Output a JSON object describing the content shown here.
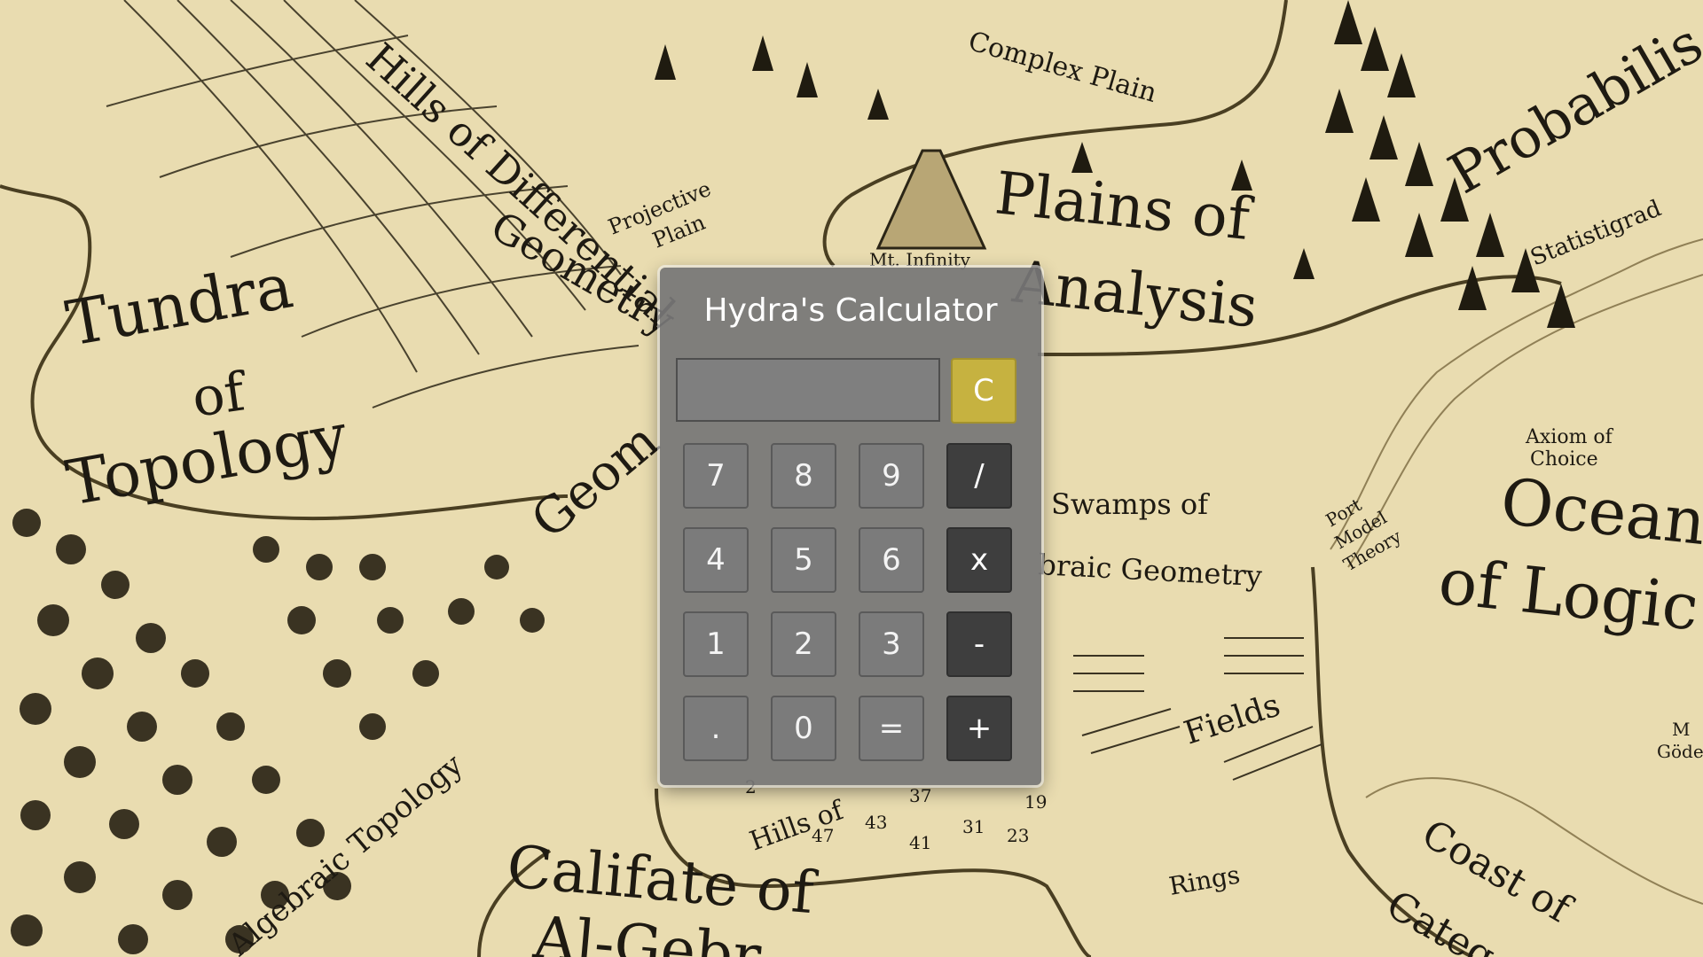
{
  "map": {
    "region_labels": [
      "Tundra",
      "of",
      "Topology",
      "Hills of Differential",
      "Geometry",
      "Plains of",
      "Analysis",
      "Complex Plain",
      "Projective",
      "Plain",
      "Mt. Infinity",
      "Probabilis",
      "Statistigrad",
      "Axiom of",
      "Choice",
      "Ocean",
      "of Logic",
      "Swamps of",
      "braic Geometry",
      "Port",
      "Model",
      "Theory",
      "Fields",
      "Califate of",
      "Al-Gebr",
      "Algebraic Topology",
      "Rings",
      "Coast of",
      "Catego",
      "Hills of",
      "Geom",
      "M",
      "Göde"
    ],
    "hill_numbers": [
      "43",
      "41",
      "47",
      "31",
      "37",
      "23",
      "19",
      "2"
    ]
  },
  "calculator": {
    "title": "Hydra's Calculator",
    "display_value": "",
    "clear_label": "C",
    "keys": {
      "k7": "7",
      "k8": "8",
      "k9": "9",
      "div": "/",
      "k4": "4",
      "k5": "5",
      "k6": "6",
      "mul": "x",
      "k1": "1",
      "k2": "2",
      "k3": "3",
      "sub": "-",
      "dot": ".",
      "k0": "0",
      "eq": "=",
      "add": "+"
    },
    "colors": {
      "panel": "#767676",
      "number_key": "#7b7b7b",
      "operator_key": "#3e3e3e",
      "clear_key": "#c6b240"
    }
  }
}
